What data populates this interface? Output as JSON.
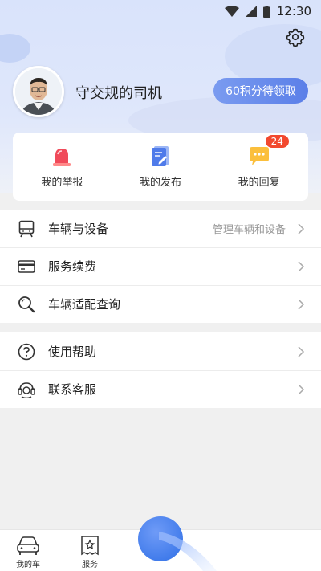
{
  "status_bar": {
    "time": "12:30"
  },
  "profile": {
    "username": "守交规的司机",
    "points_button": "60积分待领取"
  },
  "quick_actions": [
    {
      "label": "我的举报"
    },
    {
      "label": "我的发布"
    },
    {
      "label": "我的回复",
      "badge": "24"
    }
  ],
  "menu_group1": [
    {
      "label": "车辆与设备",
      "hint": "管理车辆和设备",
      "icon": "vehicle-device-icon"
    },
    {
      "label": "服务续费",
      "icon": "card-icon"
    },
    {
      "label": "车辆适配查询",
      "icon": "search-icon"
    }
  ],
  "menu_group2": [
    {
      "label": "使用帮助",
      "icon": "help-icon"
    },
    {
      "label": "联系客服",
      "icon": "headset-icon"
    }
  ],
  "tabbar": {
    "my_car": "我的车",
    "service": "服务"
  },
  "colors": {
    "accent": "#5b7fe8",
    "badge": "#f2492f",
    "header_bg": "#d9e3fb"
  }
}
